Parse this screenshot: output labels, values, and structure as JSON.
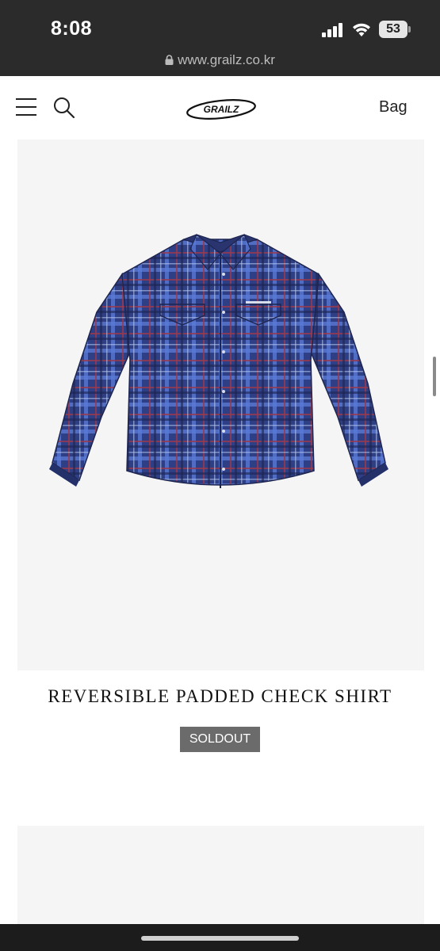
{
  "status_bar": {
    "time": "8:08",
    "battery_level": "53",
    "url": "www.grailz.co.kr"
  },
  "header": {
    "logo_text": "GRAILZ",
    "bag_label": "Bag"
  },
  "product": {
    "title": "REVERSIBLE PADDED CHECK SHIRT",
    "badge": "SOLDOUT",
    "image_subject": "navy-plaid-shirt"
  },
  "colors": {
    "status_bar_bg": "#2b2b2b",
    "card_bg": "#f5f5f5",
    "badge_bg": "#6b6b6b",
    "shirt_navy": "#2a3a7a"
  }
}
